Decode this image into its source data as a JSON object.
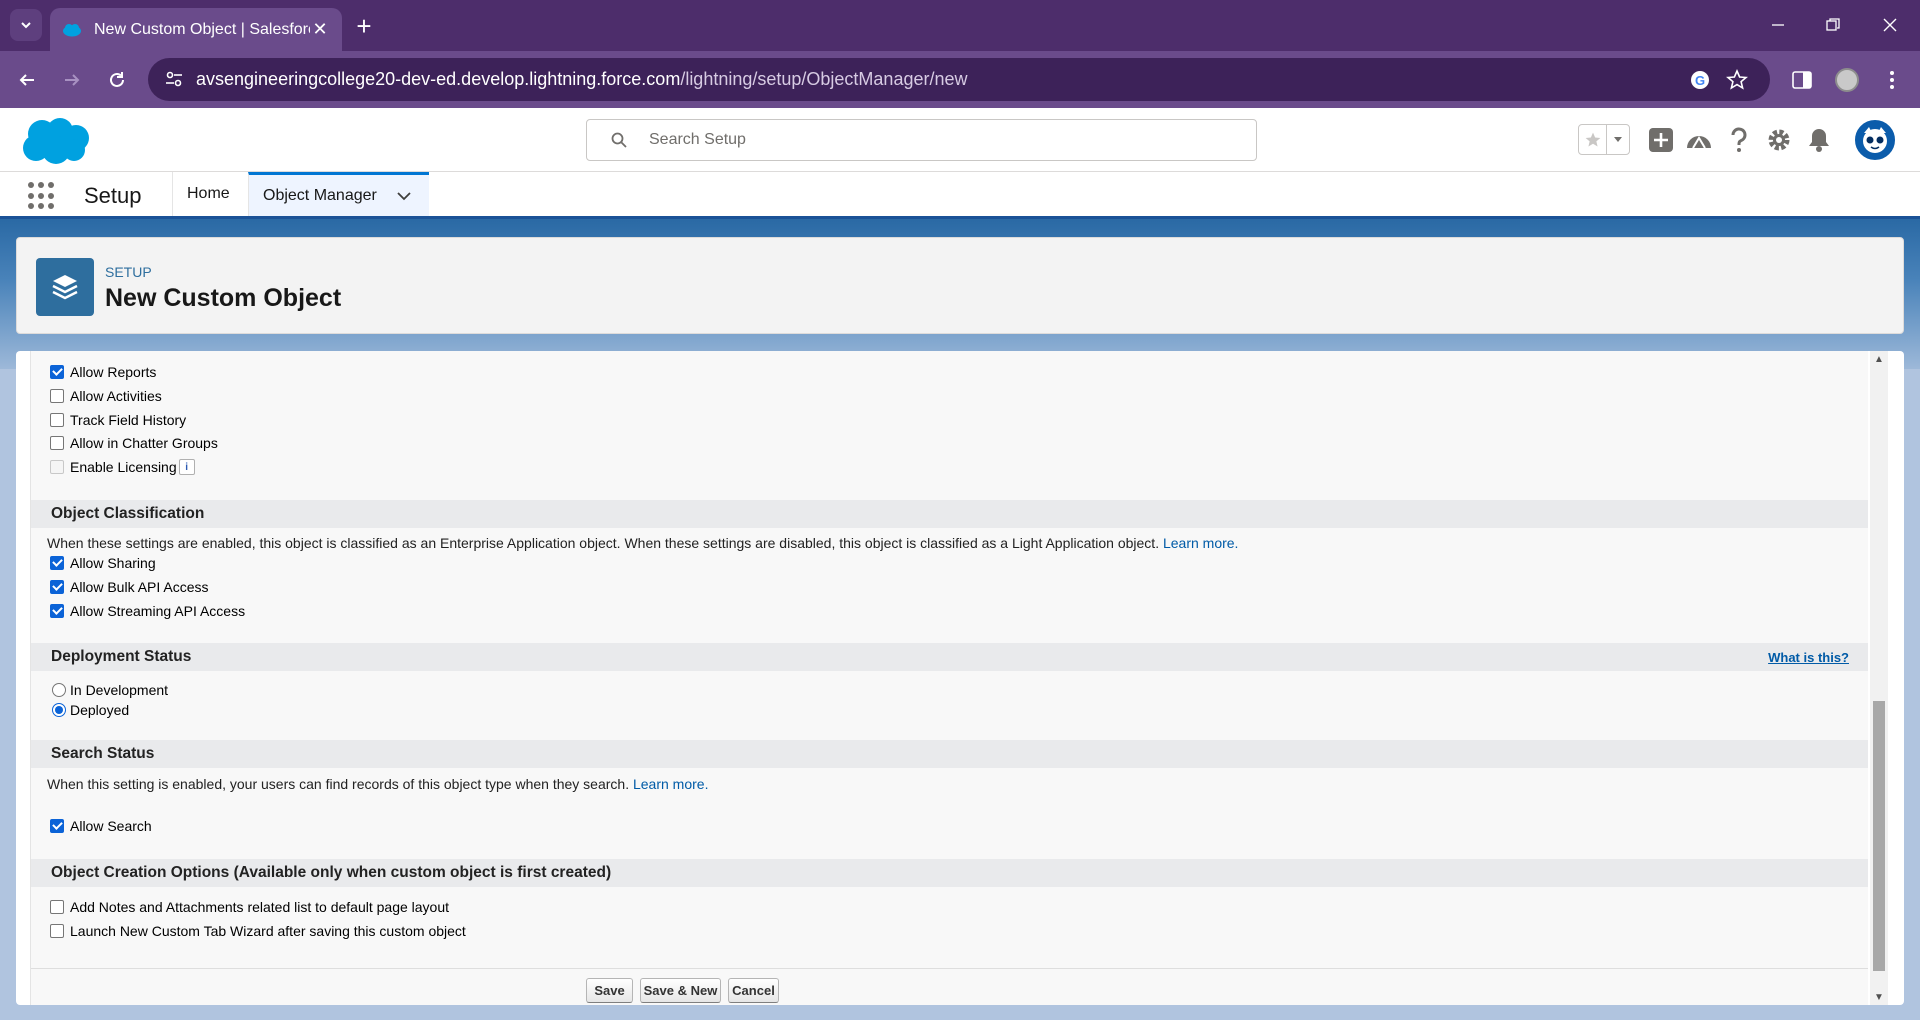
{
  "browser": {
    "tab_title": "New Custom Object | Salesforce",
    "url_host": "avsengineeringcollege20-dev-ed.develop.lightning.force.com",
    "url_path": "/lightning/setup/ObjectManager/new"
  },
  "header": {
    "search_placeholder": "Search Setup"
  },
  "nav": {
    "app_name": "Setup",
    "items": [
      {
        "label": "Home"
      },
      {
        "label": "Object Manager"
      }
    ]
  },
  "page_header": {
    "eyebrow": "SETUP",
    "title": "New Custom Object"
  },
  "optional_features": [
    {
      "label": "Allow Reports",
      "checked": true
    },
    {
      "label": "Allow Activities",
      "checked": false
    },
    {
      "label": "Track Field History",
      "checked": false
    },
    {
      "label": "Allow in Chatter Groups",
      "checked": false
    },
    {
      "label": "Enable Licensing",
      "checked": false,
      "disabled": true
    }
  ],
  "object_classification": {
    "title": "Object Classification",
    "description": "When these settings are enabled, this object is classified as an Enterprise Application object. When these settings are disabled, this object is classified as a Light Application object.",
    "learn_more": "Learn more.",
    "options": [
      {
        "label": "Allow Sharing",
        "checked": true
      },
      {
        "label": "Allow Bulk API Access",
        "checked": true
      },
      {
        "label": "Allow Streaming API Access",
        "checked": true
      }
    ]
  },
  "deployment_status": {
    "title": "Deployment Status",
    "help": "What is this?",
    "options": [
      {
        "label": "In Development",
        "selected": false
      },
      {
        "label": "Deployed",
        "selected": true
      }
    ]
  },
  "search_status": {
    "title": "Search Status",
    "description": "When this setting is enabled, your users can find records of this object type when they search.",
    "learn_more": "Learn more.",
    "option": {
      "label": "Allow Search",
      "checked": true
    }
  },
  "creation_options": {
    "title": "Object Creation Options (Available only when custom object is first created)",
    "options": [
      {
        "label": "Add Notes and Attachments related list to default page layout",
        "checked": false
      },
      {
        "label": "Launch New Custom Tab Wizard after saving this custom object",
        "checked": false
      }
    ]
  },
  "buttons": {
    "save": "Save",
    "save_new": "Save & New",
    "cancel": "Cancel"
  }
}
